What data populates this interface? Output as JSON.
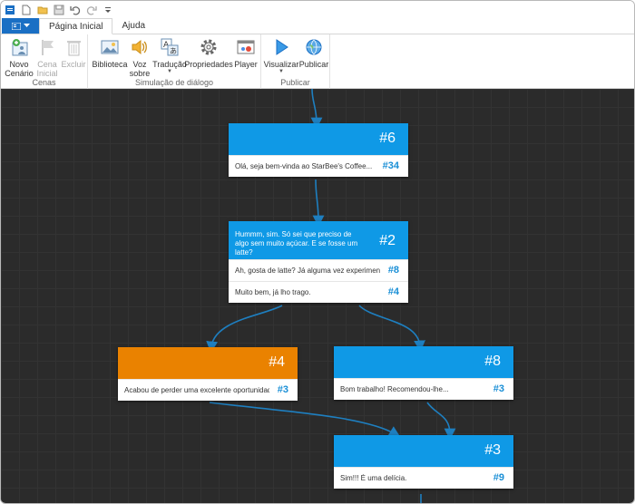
{
  "colors": {
    "accent": "#1a6fc4",
    "node_blue": "#0f99e6",
    "node_orange": "#ea8200",
    "canvas": "#2b2b2b",
    "edge": "#1e7fc0"
  },
  "qat": {
    "icons": [
      "app-icon",
      "new-icon",
      "open-icon",
      "save-icon",
      "undo-icon",
      "redo-icon",
      "customize-icon"
    ]
  },
  "tabs": [
    {
      "label": "Página Inicial"
    },
    {
      "label": "Ajuda"
    }
  ],
  "ribbon": {
    "groups": [
      {
        "label": "Cenas",
        "buttons": [
          {
            "label1": "Novo",
            "label2": "Cenário",
            "icon": "new-scene-icon"
          },
          {
            "label1": "Cena",
            "label2": "Inicial",
            "icon": "flag-icon"
          },
          {
            "label1": "Excluir",
            "label2": "",
            "icon": "trash-icon"
          }
        ]
      },
      {
        "label": "Simulação de diálogo",
        "buttons": [
          {
            "label1": "Biblioteca",
            "label2": "",
            "icon": "image-icon"
          },
          {
            "label1": "Voz",
            "label2": "sobre",
            "icon": "speaker-icon"
          },
          {
            "label1": "Tradução",
            "label2": "",
            "icon": "translate-icon"
          },
          {
            "label1": "Propriedades",
            "label2": "",
            "icon": "gear-icon"
          },
          {
            "label1": "Player",
            "label2": "",
            "icon": "player-icon"
          }
        ]
      },
      {
        "label": "Publicar",
        "buttons": [
          {
            "label1": "Visualizar",
            "label2": "",
            "icon": "play-icon"
          },
          {
            "label1": "Publicar",
            "label2": "",
            "icon": "globe-icon"
          }
        ]
      }
    ]
  },
  "nodes": [
    {
      "id": "#6",
      "head_text": "",
      "rows": [
        {
          "text": "Olá, seja bem-vinda ao  StarBee's Coffee...",
          "link": "#34"
        }
      ]
    },
    {
      "id": "#2",
      "head_text": "Hummm, sim. Só sei que preciso de algo sem muito açúcar. E se fosse um latte?",
      "rows": [
        {
          "text": "Ah, gosta de latte? Já alguma vez experimentou...",
          "link": "#8"
        },
        {
          "text": "Muito bem, já lho trago.",
          "link": "#4"
        }
      ]
    },
    {
      "id": "#4",
      "head_text": "",
      "rows": [
        {
          "text": "Acabou de perder uma excelente oportunidade...",
          "link": "#3"
        }
      ]
    },
    {
      "id": "#8",
      "head_text": "",
      "rows": [
        {
          "text": "Bom trabalho! Recomendou-lhe...",
          "link": "#3"
        }
      ]
    },
    {
      "id": "#3",
      "head_text": "",
      "rows": [
        {
          "text": "Sim!!! É uma delícia.",
          "link": "#9"
        }
      ]
    }
  ]
}
